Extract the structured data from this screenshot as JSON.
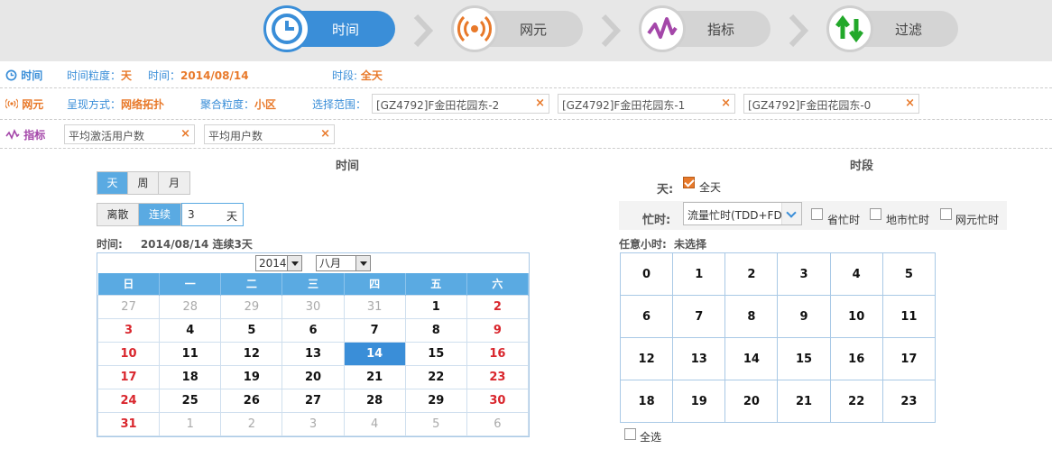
{
  "wizard": {
    "steps": [
      {
        "label": "时间",
        "icon": "clock-icon",
        "active": true
      },
      {
        "label": "网元",
        "icon": "signal-icon",
        "active": false
      },
      {
        "label": "指标",
        "icon": "wave-icon",
        "active": false
      },
      {
        "label": "过滤",
        "icon": "updown-arrows-icon",
        "active": false
      }
    ]
  },
  "summary": {
    "time": {
      "head": "时间",
      "granularity_label": "时间粒度：",
      "granularity_value": "天",
      "time_label": "时间：",
      "time_value": "2014/08/14",
      "period_label": "时段:",
      "period_value": "全天"
    },
    "element": {
      "head": "网元",
      "mode_label": "呈现方式：",
      "mode_value": "网络拓扑",
      "agg_label": "聚合粒度：",
      "agg_value": "小区",
      "range_label": "选择范围：",
      "ranges": [
        "[GZ4792]F金田花园东-2",
        "[GZ4792]F金田花园东-1",
        "[GZ4792]F金田花园东-0"
      ]
    },
    "indicator": {
      "head": "指标",
      "items": [
        "平均激活用户数",
        "平均用户数"
      ]
    }
  },
  "time_panel": {
    "title": "时间",
    "granularity": [
      "天",
      "周",
      "月"
    ],
    "granularity_selected": "天",
    "mode": [
      "离散",
      "连续"
    ],
    "mode_selected": "连续",
    "count_value": "3",
    "count_unit": "天",
    "info_label": "时间:",
    "info_value": "2014/08/14  连续3天"
  },
  "calendar": {
    "year": "2014",
    "month": "八月",
    "weekdays": [
      "日",
      "一",
      "二",
      "三",
      "四",
      "五",
      "六"
    ],
    "weeks": [
      [
        "27",
        "28",
        "29",
        "30",
        "31",
        "1",
        "2"
      ],
      [
        "3",
        "4",
        "5",
        "6",
        "7",
        "8",
        "9"
      ],
      [
        "10",
        "11",
        "12",
        "13",
        "14",
        "15",
        "16"
      ],
      [
        "17",
        "18",
        "19",
        "20",
        "21",
        "22",
        "23"
      ],
      [
        "24",
        "25",
        "26",
        "27",
        "28",
        "29",
        "30"
      ],
      [
        "31",
        "1",
        "2",
        "3",
        "4",
        "5",
        "6"
      ]
    ],
    "selected": "14"
  },
  "period_panel": {
    "title": "时段",
    "day_label": "天:",
    "allday_label": "全天",
    "allday_checked": true,
    "busy_label": "忙时:",
    "busy_select": "流量忙时(TDD+FDD)",
    "busy_options": [
      "省忙时",
      "地市忙时",
      "网元忙时"
    ],
    "hours_label": "任意小时:",
    "hours_value": "未选择",
    "hours": [
      "0",
      "1",
      "2",
      "3",
      "4",
      "5",
      "6",
      "7",
      "8",
      "9",
      "10",
      "11",
      "12",
      "13",
      "14",
      "15",
      "16",
      "17",
      "18",
      "19",
      "20",
      "21",
      "22",
      "23"
    ],
    "select_all_label": "全选"
  },
  "colors": {
    "accent": "#3a8ed8",
    "orange": "#e8792a",
    "weekend_red": "#d9262d",
    "purple": "#a447a9"
  }
}
